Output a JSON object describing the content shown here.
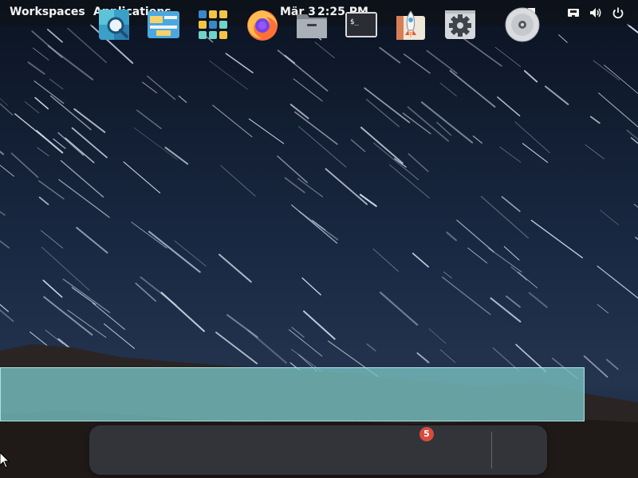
{
  "panel": {
    "workspaces_label": "Workspaces",
    "applications_label": "Applications",
    "date": "Mär 3",
    "time": "2:25 PM",
    "indicators": [
      "multitasking-icon",
      "network-icon",
      "volume-icon",
      "power-icon"
    ]
  },
  "dock": {
    "apps": [
      {
        "name": "search-icon",
        "color": "#3a9fd6"
      },
      {
        "name": "files-window-icon",
        "color": "#47a7e0"
      },
      {
        "name": "app-grid-icon",
        "color": "#f4c542"
      },
      {
        "name": "firefox-icon",
        "color": "#ff7139"
      },
      {
        "name": "folder-icon",
        "color": "#9aa1ab"
      },
      {
        "name": "terminal-icon",
        "color": "#2c2f36"
      },
      {
        "name": "appcenter-icon",
        "color": "#e8e2d6"
      },
      {
        "name": "settings-icon",
        "color": "#555b63"
      },
      {
        "name": "disc-icon",
        "color": "#d5d7da"
      }
    ],
    "badge_count": "5"
  },
  "colors": {
    "selection": "#7ac4c4",
    "panel_text": "#f3f3f3"
  }
}
